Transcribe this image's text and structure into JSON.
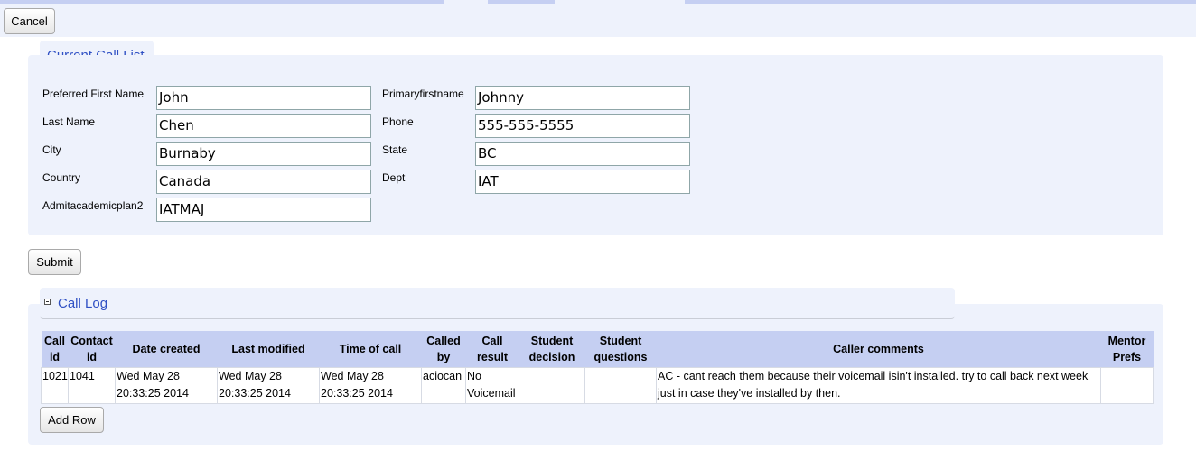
{
  "toolbar": {
    "cancel_label": "Cancel"
  },
  "call_list": {
    "title": "Current Call List",
    "fields": {
      "preferred_first_name": {
        "label": "Preferred First Name",
        "value": "John"
      },
      "last_name": {
        "label": "Last Name",
        "value": "Chen"
      },
      "city": {
        "label": "City",
        "value": "Burnaby"
      },
      "country": {
        "label": "Country",
        "value": "Canada"
      },
      "admit_academic_plan2": {
        "label": "Admitacademicplan2",
        "value": "IATMAJ"
      },
      "primary_first_name": {
        "label": "Primaryfirstname",
        "value": "Johnny"
      },
      "phone": {
        "label": "Phone",
        "value": "555-555-5555"
      },
      "state": {
        "label": "State",
        "value": "BC"
      },
      "dept": {
        "label": "Dept",
        "value": "IAT"
      }
    },
    "submit_label": "Submit"
  },
  "call_log": {
    "title": "Call Log",
    "columns": [
      "Call id",
      "Contact id",
      "Date created",
      "Last modified",
      "Time of call",
      "Called by",
      "Call result",
      "Student decision",
      "Student questions",
      "Caller comments",
      "Mentor Prefs"
    ],
    "rows": [
      {
        "call_id": "1021",
        "contact_id": "1041",
        "date_created": "Wed May 28 20:33:25 2014",
        "last_modified": "Wed May 28 20:33:25 2014",
        "time_of_call": "Wed May 28 20:33:25 2014",
        "called_by": "aciocan",
        "call_result": "No Voicemail",
        "student_decision": "",
        "student_questions": "",
        "caller_comments": "AC - cant reach them because their voicemail isin't installed. try to call back next week just in case they've installed by then.",
        "mentor_prefs": ""
      }
    ],
    "add_row_label": "Add Row"
  },
  "colors": {
    "panel_bg": "#eef2fc",
    "header_bg": "#c5cff2",
    "legend_text": "#2f50c4"
  }
}
